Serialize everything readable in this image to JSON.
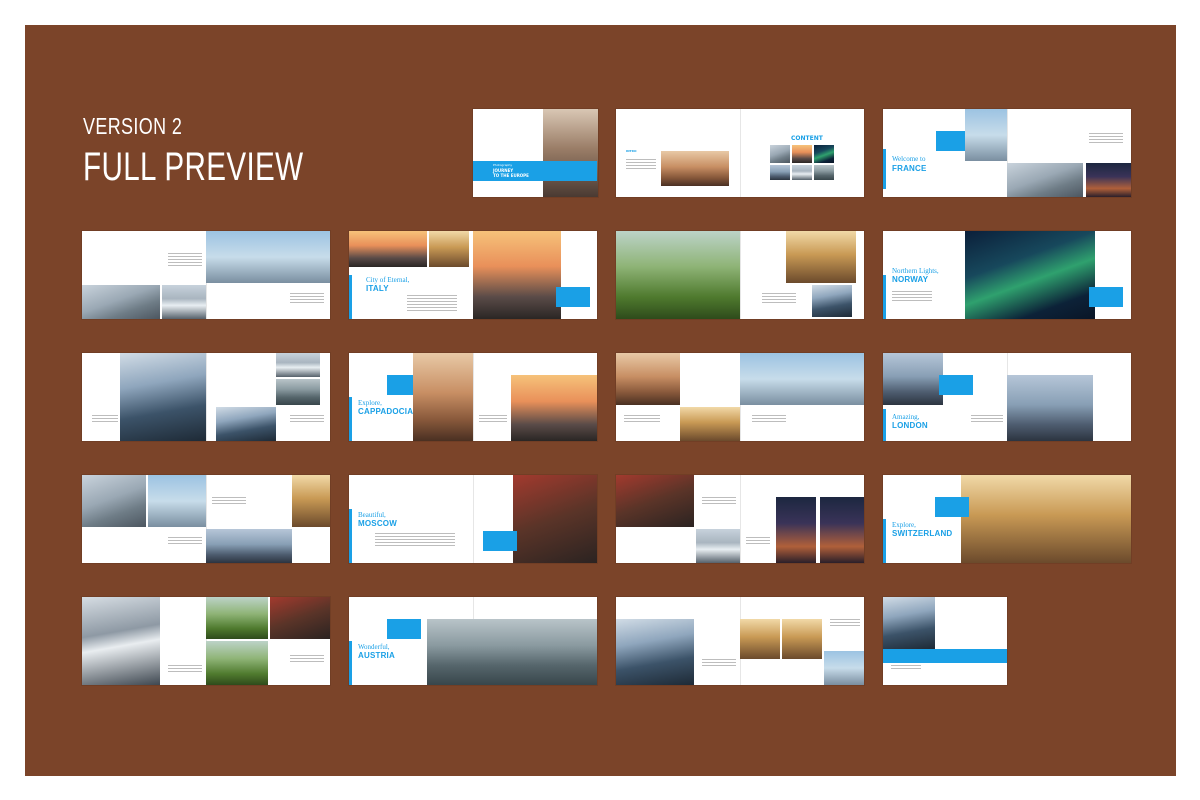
{
  "header": {
    "version": "VERSION 2",
    "preview": "FULL PREVIEW"
  },
  "cover": {
    "line1": "Photography",
    "line2": "JOURNEY",
    "line3": "TO THE EUROPE"
  },
  "contents": {
    "title": "CONTENT",
    "intro_label": "INTRO"
  },
  "headings": {
    "france_light": "Welcome to",
    "france_bold": "FRANCE",
    "italy_light": "City of Eternal,",
    "italy_bold": "ITALY",
    "norway_light": "Northern Lights,",
    "norway_bold": "NORWAY",
    "cappadocia_light": "Explore,",
    "cappadocia_bold": "CAPPADOCIA",
    "london_light": "Amazing,",
    "london_bold": "LONDON",
    "moscow_light": "Beautiful,",
    "moscow_bold": "MOSCOW",
    "switzerland_light": "Explore,",
    "switzerland_bold": "SWITZERLAND",
    "austria_light": "Wonderful,",
    "austria_bold": "AUSTRIA"
  }
}
